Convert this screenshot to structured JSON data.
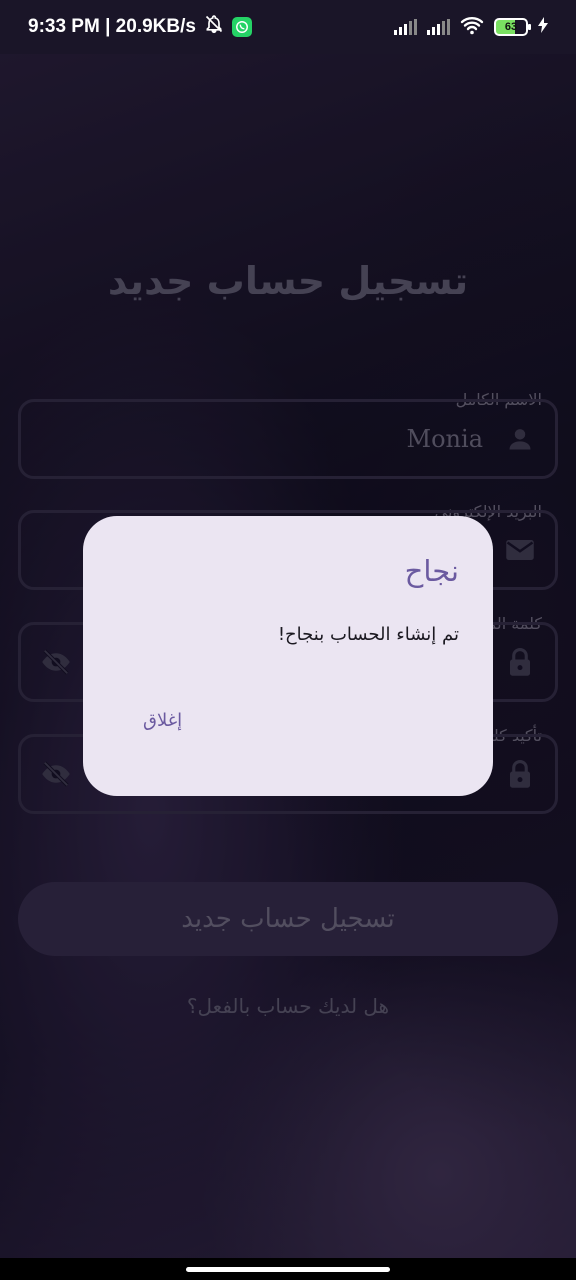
{
  "status_bar": {
    "time_speed": "9:33 PM | 20.9KB/s",
    "battery": "63",
    "icons": [
      "bell-off-icon",
      "whatsapp-icon",
      "signal-icon",
      "signal-icon",
      "wifi-icon",
      "battery-icon",
      "charging-icon"
    ]
  },
  "form": {
    "title": "تسجيل حساب جديد",
    "fields": [
      {
        "label": "الاسم الكامل",
        "value": "Monia",
        "icon": "person-icon"
      },
      {
        "label": "البريد الإلكتروني",
        "value": "",
        "icon": "email-icon"
      },
      {
        "label": "كلمة المرور",
        "value": "",
        "icon": "lock-icon",
        "toggle_icon": "eye-off-icon"
      },
      {
        "label": "تأكيد كلمة المرور",
        "value": "",
        "icon": "lock-icon",
        "toggle_icon": "eye-off-icon"
      }
    ],
    "register_button": "تسجيل حساب جديد",
    "login_prompt": "هل لديك حساب بالفعل؟"
  },
  "dialog": {
    "title": "نجاح",
    "message": "تم إنشاء الحساب بنجاح!",
    "close_button": "إغلاق"
  },
  "colors": {
    "accent": "#6b5aa0",
    "dialog_bg": "#ebe5f2",
    "button_bg": "#3d3257"
  }
}
